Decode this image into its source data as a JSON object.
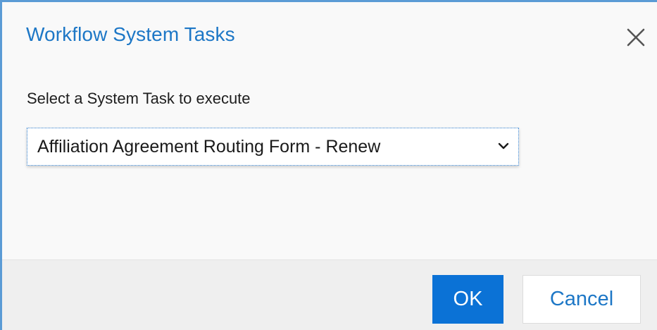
{
  "dialog": {
    "title": "Workflow System Tasks",
    "close_icon": "close-icon",
    "label": "Select a System Task to execute",
    "select": {
      "selected": "Affiliation Agreement Routing Form - Renew",
      "chevron_icon": "chevron-down-icon"
    },
    "buttons": {
      "ok": "OK",
      "cancel": "Cancel"
    }
  },
  "colors": {
    "accent": "#1d77c6",
    "primary_button": "#0b72d6",
    "frame_border": "#5b9bd5",
    "body_background": "#f9f9f9",
    "footer_background": "#efefef"
  }
}
